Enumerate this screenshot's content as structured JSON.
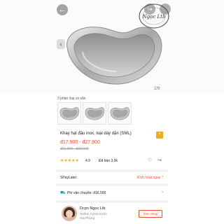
{
  "gallery": {
    "counter": "2/9",
    "variants_label": "3 phân loại có sẵn",
    "stamp_text": "Ngọc Ltb"
  },
  "product": {
    "title": "Khay hạt đậu inox, loại dày dặn (SML)",
    "flag_text": "VN",
    "price": "đ17.900 - đ27.900",
    "old_price": "đ21.900 - đ29.900",
    "rating": "4.9",
    "sold": "Đã bán 3,9k",
    "rating_stars": 5
  },
  "rows": {
    "spaylater_label": "SPayLater",
    "spaylater_link": "Kích hoạt ngay",
    "shipping_label": "Phí vận chuyển: đ16.500"
  },
  "shop": {
    "name": "Dcpn Ngọc Ltb",
    "online": "Online 3 phút trước",
    "location": "Hải Phòng",
    "view_label": "Xem Shop"
  },
  "colors": {
    "accent": "#ee4d2d",
    "star": "#f5a623"
  }
}
